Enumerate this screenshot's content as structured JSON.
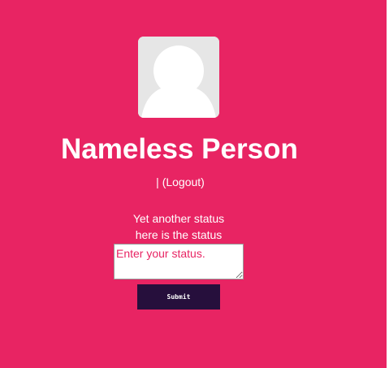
{
  "profile": {
    "name": "Nameless Person",
    "separator": "| ",
    "logout_label": "(Logout)"
  },
  "status": {
    "lines": [
      "Yet another status",
      "here is the status"
    ],
    "input_placeholder": "Enter your status.",
    "input_value": "",
    "submit_label": "Submit"
  },
  "icons": {
    "avatar": "default-user-silhouette-icon"
  },
  "colors": {
    "background": "#e82463",
    "button": "#260f3c",
    "text": "#ffffff",
    "avatar_bg": "#e6e6e6"
  }
}
